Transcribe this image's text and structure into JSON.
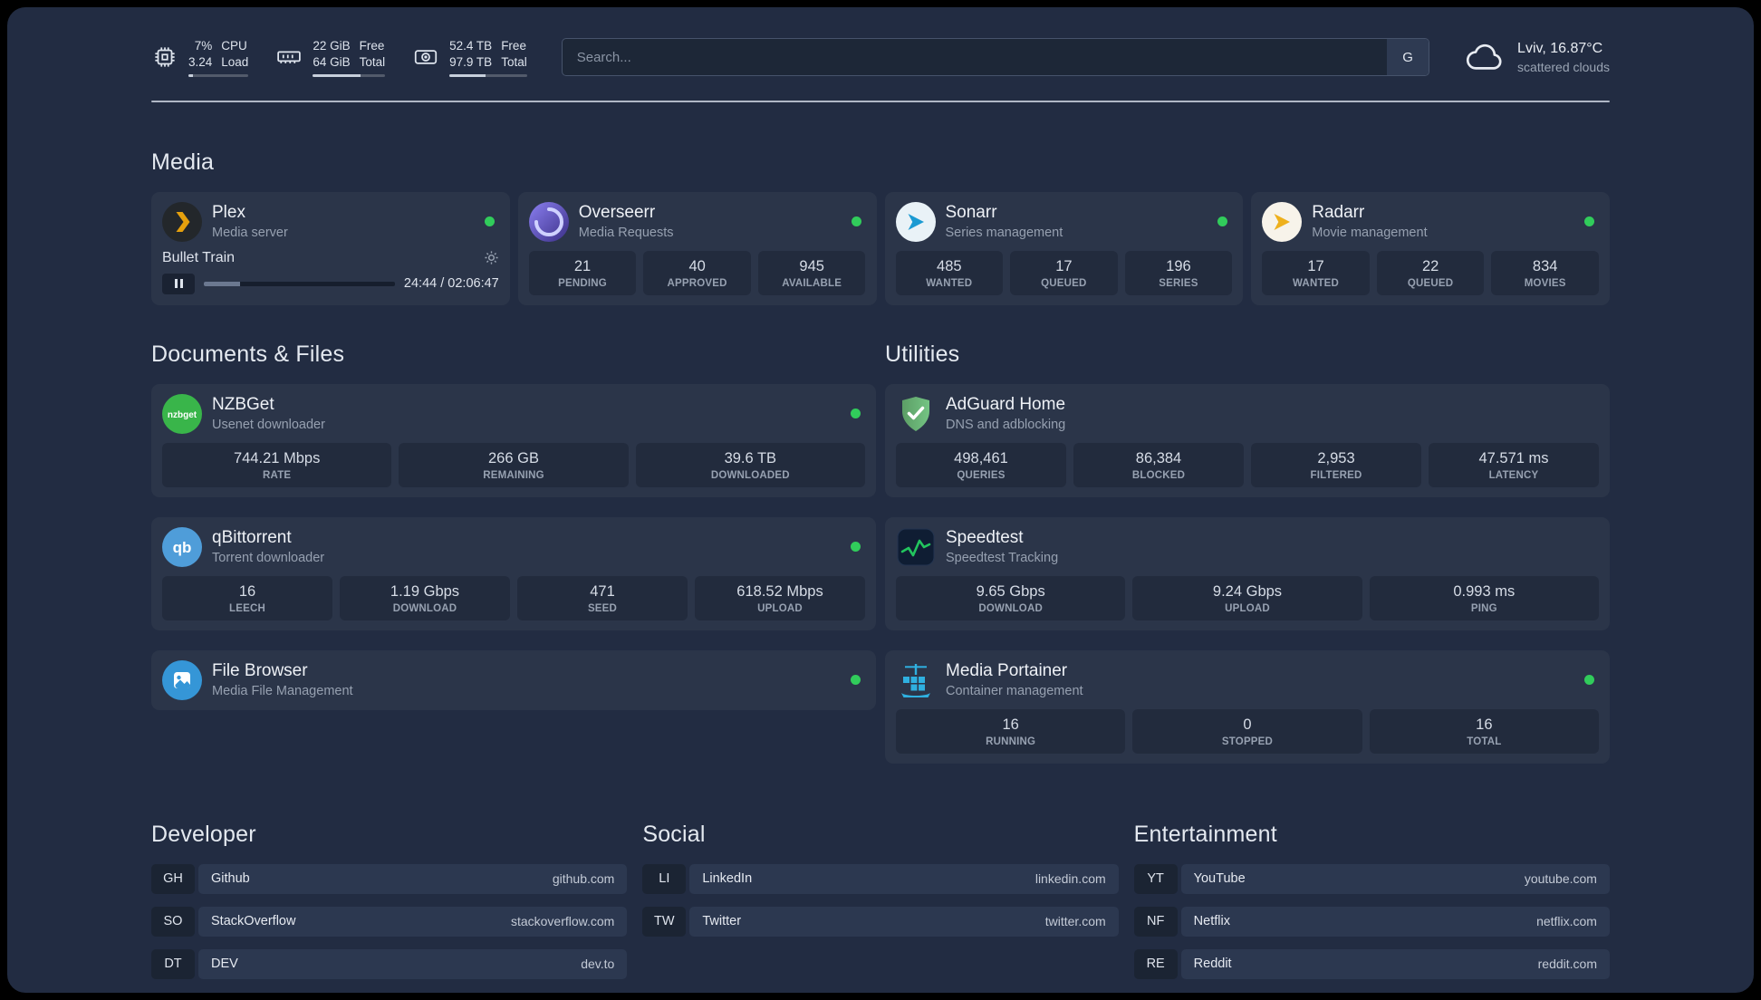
{
  "colors": {
    "background": "#222c42",
    "card": "#2b3549",
    "stat_block": "#222b3d",
    "status_online": "#31cc5b",
    "plex_accent": "#e5a00d",
    "overseerr_accent": "#6a5acd",
    "sonarr_accent": "#1b9ad2",
    "radarr_accent": "#eeb01c",
    "nzbget_accent": "#39b54a",
    "qbittorrent_accent": "#4f9dd9",
    "filebrowser_accent": "#3596d7",
    "adguard_accent": "#6ab475",
    "speedtest_accent": "#22c55e",
    "portainer_accent": "#2fb0e0"
  },
  "topbar": {
    "cpu": {
      "value_top": "7%",
      "value_bottom": "3.24",
      "label_top": "CPU",
      "label_bottom": "Load",
      "bar_pct": 7
    },
    "memory": {
      "value_top": "22 GiB",
      "value_bottom": "64 GiB",
      "label_top": "Free",
      "label_bottom": "Total",
      "bar_pct": 66
    },
    "disk": {
      "value_top": "52.4 TB",
      "value_bottom": "97.9 TB",
      "label_top": "Free",
      "label_bottom": "Total",
      "bar_pct": 47
    },
    "search": {
      "placeholder": "Search...",
      "provider_button": "G"
    },
    "weather": {
      "location": "Lviv, 16.87°C",
      "condition": "scattered clouds"
    }
  },
  "sections": {
    "media": {
      "title": "Media"
    },
    "documents": {
      "title": "Documents & Files"
    },
    "utilities": {
      "title": "Utilities"
    },
    "developer": {
      "title": "Developer"
    },
    "social": {
      "title": "Social"
    },
    "entertainment": {
      "title": "Entertainment"
    }
  },
  "services": {
    "plex": {
      "name": "Plex",
      "subtitle": "Media server",
      "status": "online",
      "player": {
        "track": "Bullet Train",
        "time": "24:44 / 02:06:47",
        "progress_pct": 19
      }
    },
    "overseerr": {
      "name": "Overseerr",
      "subtitle": "Media Requests",
      "status": "online",
      "stats": [
        {
          "value": "21",
          "label": "PENDING"
        },
        {
          "value": "40",
          "label": "APPROVED"
        },
        {
          "value": "945",
          "label": "AVAILABLE"
        }
      ]
    },
    "sonarr": {
      "name": "Sonarr",
      "subtitle": "Series management",
      "status": "online",
      "stats": [
        {
          "value": "485",
          "label": "WANTED"
        },
        {
          "value": "17",
          "label": "QUEUED"
        },
        {
          "value": "196",
          "label": "SERIES"
        }
      ]
    },
    "radarr": {
      "name": "Radarr",
      "subtitle": "Movie management",
      "status": "online",
      "stats": [
        {
          "value": "17",
          "label": "WANTED"
        },
        {
          "value": "22",
          "label": "QUEUED"
        },
        {
          "value": "834",
          "label": "MOVIES"
        }
      ]
    },
    "nzbget": {
      "name": "NZBGet",
      "subtitle": "Usenet downloader",
      "status": "online",
      "icon_text": "nzbget",
      "stats": [
        {
          "value": "744.21 Mbps",
          "label": "RATE"
        },
        {
          "value": "266 GB",
          "label": "REMAINING"
        },
        {
          "value": "39.6 TB",
          "label": "DOWNLOADED"
        }
      ]
    },
    "qbittorrent": {
      "name": "qBittorrent",
      "subtitle": "Torrent downloader",
      "status": "online",
      "icon_text": "qb",
      "stats": [
        {
          "value": "16",
          "label": "LEECH"
        },
        {
          "value": "1.19 Gbps",
          "label": "DOWNLOAD"
        },
        {
          "value": "471",
          "label": "SEED"
        },
        {
          "value": "618.52 Mbps",
          "label": "UPLOAD"
        }
      ]
    },
    "filebrowser": {
      "name": "File Browser",
      "subtitle": "Media File Management",
      "status": "online"
    },
    "adguard": {
      "name": "AdGuard Home",
      "subtitle": "DNS and adblocking",
      "stats": [
        {
          "value": "498,461",
          "label": "QUERIES"
        },
        {
          "value": "86,384",
          "label": "BLOCKED"
        },
        {
          "value": "2,953",
          "label": "FILTERED"
        },
        {
          "value": "47.571 ms",
          "label": "LATENCY"
        }
      ]
    },
    "speedtest": {
      "name": "Speedtest",
      "subtitle": "Speedtest Tracking",
      "stats": [
        {
          "value": "9.65 Gbps",
          "label": "DOWNLOAD"
        },
        {
          "value": "9.24 Gbps",
          "label": "UPLOAD"
        },
        {
          "value": "0.993 ms",
          "label": "PING"
        }
      ]
    },
    "portainer": {
      "name": "Media Portainer",
      "subtitle": "Container management",
      "status": "online",
      "stats": [
        {
          "value": "16",
          "label": "RUNNING"
        },
        {
          "value": "0",
          "label": "STOPPED"
        },
        {
          "value": "16",
          "label": "TOTAL"
        }
      ]
    }
  },
  "bookmarks": {
    "developer": [
      {
        "abbr": "GH",
        "name": "Github",
        "domain": "github.com"
      },
      {
        "abbr": "SO",
        "name": "StackOverflow",
        "domain": "stackoverflow.com"
      },
      {
        "abbr": "DT",
        "name": "DEV",
        "domain": "dev.to"
      }
    ],
    "social": [
      {
        "abbr": "LI",
        "name": "LinkedIn",
        "domain": "linkedin.com"
      },
      {
        "abbr": "TW",
        "name": "Twitter",
        "domain": "twitter.com"
      }
    ],
    "entertainment": [
      {
        "abbr": "YT",
        "name": "YouTube",
        "domain": "youtube.com"
      },
      {
        "abbr": "NF",
        "name": "Netflix",
        "domain": "netflix.com"
      },
      {
        "abbr": "RE",
        "name": "Reddit",
        "domain": "reddit.com"
      }
    ]
  }
}
